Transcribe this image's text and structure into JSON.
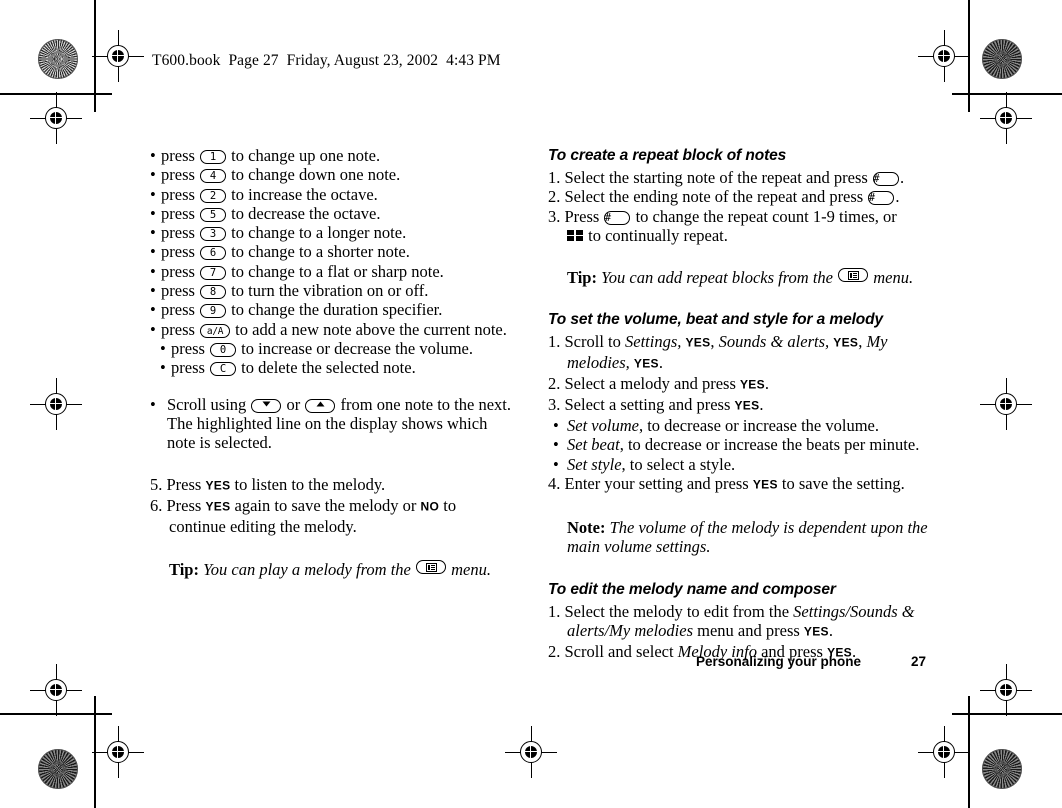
{
  "header": {
    "text": "T600.book  Page 27  Friday, August 23, 2002  4:43 PM"
  },
  "footer": {
    "section_title": "Personalizing your phone",
    "page_number": "27"
  },
  "left_column": {
    "key_bullets": [
      {
        "press": "press",
        "key": "1",
        "text": "to change up one note."
      },
      {
        "press": "press",
        "key": "4",
        "text": "to change down one note."
      },
      {
        "press": "press",
        "key": "2",
        "text": "to increase the octave."
      },
      {
        "press": "press",
        "key": "5",
        "text": "to decrease the octave."
      },
      {
        "press": "press",
        "key": "3",
        "text": "to change to a longer note."
      },
      {
        "press": "press",
        "key": "6",
        "text": "to change to a shorter note."
      },
      {
        "press": "press",
        "key": "7",
        "text": "to change to a flat or sharp note."
      },
      {
        "press": "press",
        "key": "8",
        "text": "to turn the vibration on or off."
      },
      {
        "press": "press",
        "key": "9",
        "text": "to change the duration specifier."
      },
      {
        "press": "press",
        "key": "a/A",
        "text": "to add a new note above the current note."
      },
      {
        "press": "press",
        "key": "0",
        "text": "to increase or decrease the volume."
      },
      {
        "press": "press",
        "key": "C",
        "text": "to delete the selected note."
      }
    ],
    "scroll_bullet": {
      "prefix": "Scroll using",
      "key_down": "scroll-down-key",
      "conjunction": "or",
      "key_up": "scroll-up-key",
      "suffix": "from one note to the next. The highlighted line on the display shows which note is selected."
    },
    "steps": [
      {
        "num": "5.",
        "text_before": "Press ",
        "softkey_1": "YES",
        "text_after": " to listen to the melody."
      },
      {
        "num": "6.",
        "text_before": "Press ",
        "softkey_1": "YES",
        "text_mid": " again to save the melody or ",
        "softkey_2": "NO",
        "text_after": " to continue editing the melody."
      }
    ],
    "tip": {
      "label": "Tip:",
      "text_before": "You can play a melody from the",
      "text_after": "menu."
    }
  },
  "right_column": {
    "section_1": {
      "heading": "To create a repeat block of notes",
      "steps": [
        {
          "num": "1.",
          "text_before": "Select the starting note of the repeat and press ",
          "key": "#",
          "text_after": "."
        },
        {
          "num": "2.",
          "text_before": "Select the ending note of the repeat and press ",
          "key": "#",
          "text_after": "."
        },
        {
          "num": "3.",
          "text_before": "Press ",
          "key": "#",
          "text_after": " to change the repeat count 1-9 times, or"
        }
      ],
      "continuation": "to continually repeat.",
      "tip": {
        "label": "Tip:",
        "text_before": "You can add repeat blocks from the",
        "text_after": "menu."
      }
    },
    "section_2": {
      "heading": "To set the volume, beat and style for a melody",
      "step_1": {
        "num": "1.",
        "t0": "Scroll to ",
        "i1": "Settings,",
        "sk1": "YES",
        "t1": ", ",
        "i2": "Sounds & alerts,",
        "sk2": "YES",
        "t2": ", ",
        "i3": "My melodies,",
        "sk3": "YES",
        "t3": "."
      },
      "step_2": {
        "num": "2.",
        "text_before": "Select a melody and press ",
        "softkey": "YES",
        "text_after": "."
      },
      "step_3": {
        "num": "3.",
        "text_before": "Select a setting and press ",
        "softkey": "YES",
        "text_after": "."
      },
      "sub_bullets": [
        {
          "term": "Set volume",
          "text": ", to decrease or increase the volume."
        },
        {
          "term": "Set beat",
          "text": ", to decrease or increase the beats per minute."
        },
        {
          "term": "Set style",
          "text": ", to select a style."
        }
      ],
      "step_4": {
        "num": "4.",
        "text_before": "Enter your setting and press ",
        "softkey": "YES",
        "text_after": " to save the setting."
      },
      "note": {
        "label": "Note:",
        "text": "The volume of the melody is dependent upon the main volume settings."
      }
    },
    "section_3": {
      "heading": "To edit the melody name and composer",
      "step_1": {
        "num": "1.",
        "t0": "Select the melody to edit from the ",
        "i1": "Settings/Sounds & alerts/My melodies",
        "t1": " menu and press ",
        "sk1": "YES",
        "t2": "."
      },
      "step_2": {
        "num": "2.",
        "t0": "Scroll and select ",
        "i1": "Melody info",
        "t1": " and press ",
        "sk1": "YES",
        "t2": "."
      }
    }
  },
  "icons": {
    "registration_mark": "crosshair-registration-icon",
    "color_star_target": "starburst-registration-icon",
    "repeat_forever": "repeat-forever-icon",
    "menu_key": "menu-key-icon",
    "scroll_down_key": "scroll-down-key-icon",
    "scroll_up_key": "scroll-up-key-icon"
  }
}
